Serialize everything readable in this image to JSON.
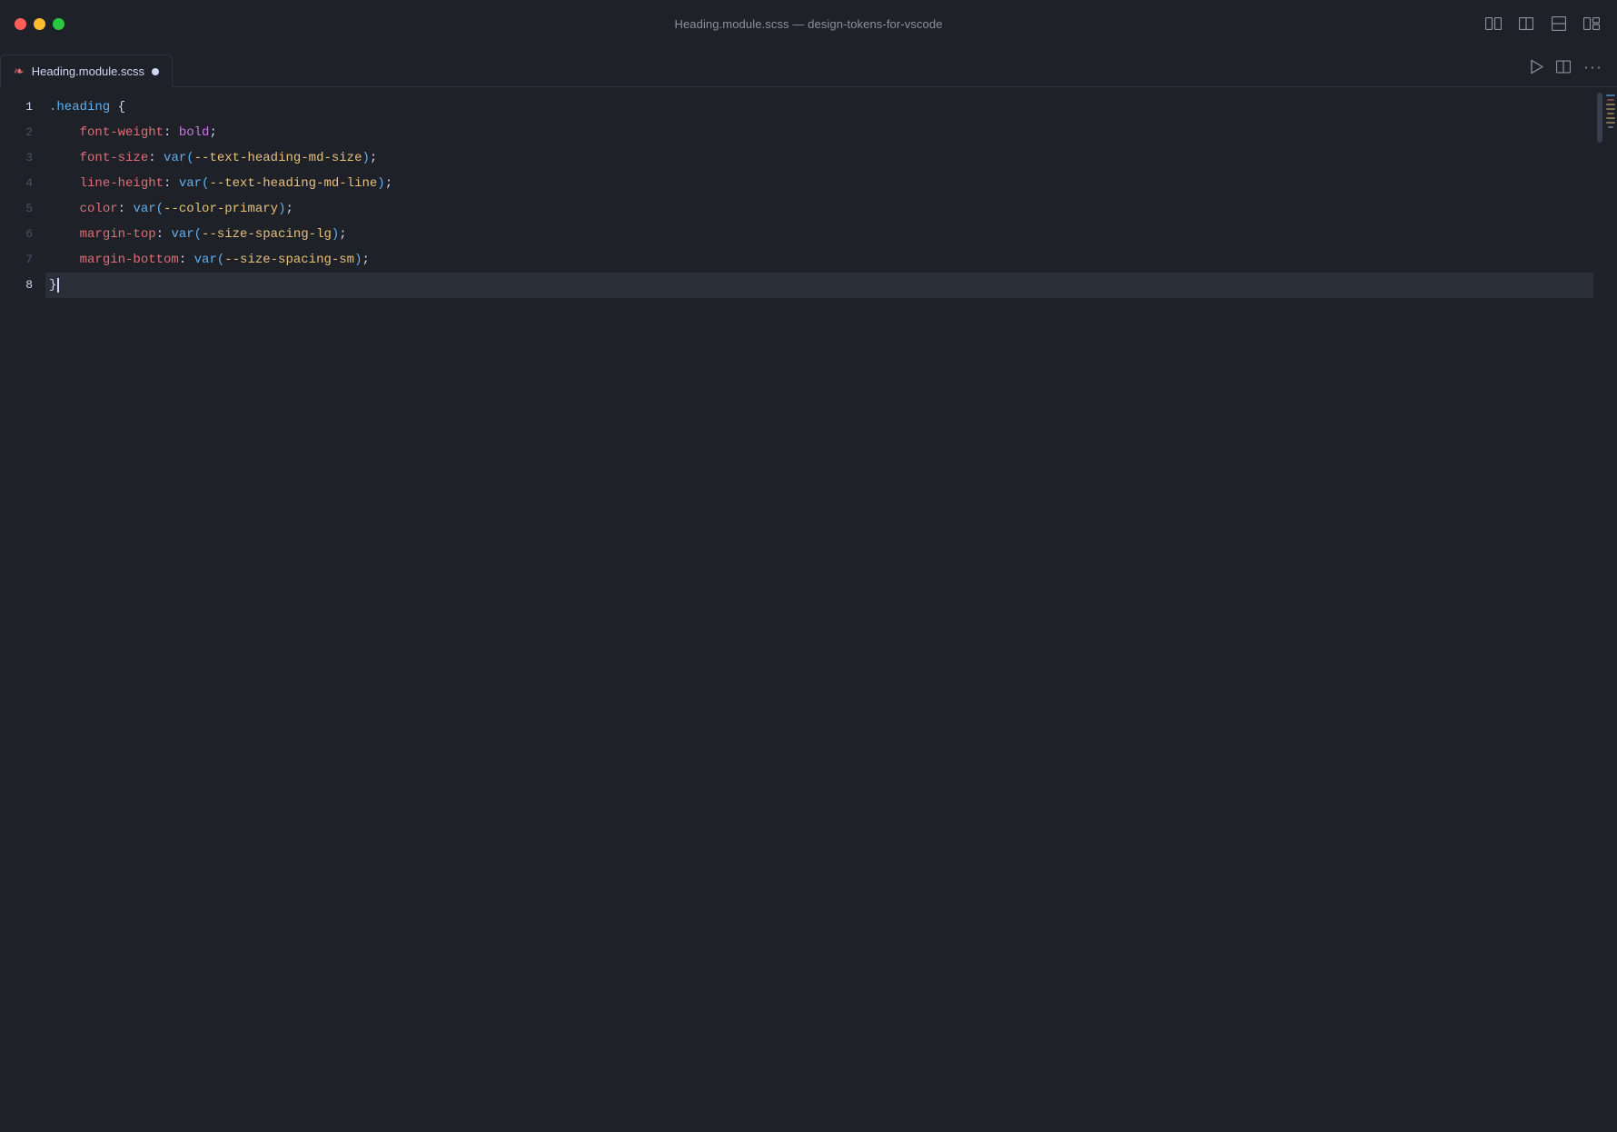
{
  "window": {
    "title": "Heading.module.scss — design-tokens-for-vscode",
    "traffic_lights": {
      "close_label": "close",
      "minimize_label": "minimize",
      "maximize_label": "maximize"
    }
  },
  "tab": {
    "icon": "❧",
    "filename": "Heading.module.scss",
    "modified": true
  },
  "titlebar_icons": [
    {
      "name": "panel-layout-icon",
      "glyph": "⬜"
    },
    {
      "name": "split-horizontal-icon",
      "glyph": "▭"
    },
    {
      "name": "split-vertical-icon",
      "glyph": "▯"
    },
    {
      "name": "more-options-icon",
      "glyph": "⋮"
    }
  ],
  "tabbar_right_icons": [
    {
      "name": "run-icon",
      "glyph": "▶"
    },
    {
      "name": "split-editor-icon",
      "glyph": "⊟"
    },
    {
      "name": "more-actions-icon",
      "glyph": "⋯"
    }
  ],
  "code": {
    "lines": [
      {
        "number": "1",
        "tokens": [
          {
            "type": "selector",
            "text": ".heading"
          },
          {
            "type": "space",
            "text": " "
          },
          {
            "type": "brace",
            "text": "{"
          }
        ],
        "active": false
      },
      {
        "number": "2",
        "tokens": [
          {
            "type": "indent",
            "text": "    "
          },
          {
            "type": "property",
            "text": "font-weight"
          },
          {
            "type": "colon",
            "text": ": "
          },
          {
            "type": "value-keyword",
            "text": "bold"
          },
          {
            "type": "semicolon",
            "text": ";"
          }
        ],
        "active": false
      },
      {
        "number": "3",
        "tokens": [
          {
            "type": "indent",
            "text": "    "
          },
          {
            "type": "property",
            "text": "font-size"
          },
          {
            "type": "colon",
            "text": ": "
          },
          {
            "type": "fn",
            "text": "var("
          },
          {
            "type": "var-name",
            "text": "--text-heading-md-size"
          },
          {
            "type": "fn-close",
            "text": ")"
          },
          {
            "type": "semicolon",
            "text": ";"
          }
        ],
        "active": false
      },
      {
        "number": "4",
        "tokens": [
          {
            "type": "indent",
            "text": "    "
          },
          {
            "type": "property",
            "text": "line-height"
          },
          {
            "type": "colon",
            "text": ": "
          },
          {
            "type": "fn",
            "text": "var("
          },
          {
            "type": "var-name",
            "text": "--text-heading-md-line"
          },
          {
            "type": "fn-close",
            "text": ")"
          },
          {
            "type": "semicolon",
            "text": ";"
          }
        ],
        "active": false
      },
      {
        "number": "5",
        "tokens": [
          {
            "type": "indent",
            "text": "    "
          },
          {
            "type": "property",
            "text": "color"
          },
          {
            "type": "colon",
            "text": ": "
          },
          {
            "type": "fn",
            "text": "var("
          },
          {
            "type": "var-name",
            "text": "--color-primary"
          },
          {
            "type": "fn-close",
            "text": ")"
          },
          {
            "type": "semicolon",
            "text": ";"
          }
        ],
        "active": false
      },
      {
        "number": "6",
        "tokens": [
          {
            "type": "indent",
            "text": "    "
          },
          {
            "type": "property",
            "text": "margin-top"
          },
          {
            "type": "colon",
            "text": ": "
          },
          {
            "type": "fn",
            "text": "var("
          },
          {
            "type": "var-name",
            "text": "--size-spacing-lg"
          },
          {
            "type": "fn-close",
            "text": ")"
          },
          {
            "type": "semicolon",
            "text": ";"
          }
        ],
        "active": false
      },
      {
        "number": "7",
        "tokens": [
          {
            "type": "indent",
            "text": "    "
          },
          {
            "type": "property",
            "text": "margin-bottom"
          },
          {
            "type": "colon",
            "text": ": "
          },
          {
            "type": "fn",
            "text": "var("
          },
          {
            "type": "var-name",
            "text": "--size-spacing-sm"
          },
          {
            "type": "fn-close",
            "text": ")"
          },
          {
            "type": "semicolon",
            "text": ";"
          }
        ],
        "active": false
      },
      {
        "number": "8",
        "tokens": [
          {
            "type": "brace",
            "text": "}"
          },
          {
            "type": "cursor",
            "text": ""
          }
        ],
        "active": true
      }
    ]
  },
  "colors": {
    "bg": "#1e2228",
    "active_line_bg": "#2a2f3a",
    "selector": "#61afef",
    "property": "#e06c75",
    "value_keyword": "#c678dd",
    "value_string": "#98c379",
    "var_name": "#e5c07b",
    "brace": "#cdd6f4",
    "line_number_inactive": "#4a5168",
    "text_default": "#cdd6f4",
    "tab_icon": "#e06c75"
  }
}
